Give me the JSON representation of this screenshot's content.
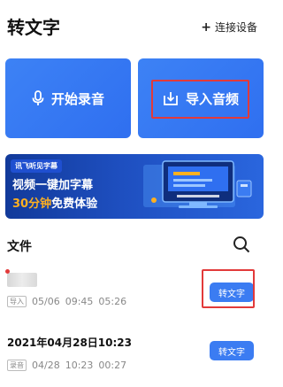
{
  "header": {
    "title": "转文字",
    "connect_label": "连接设备",
    "connect_icon": "plus-icon"
  },
  "actions": {
    "record_label": "开始录音",
    "record_icon": "microphone-icon",
    "import_label": "导入音频",
    "import_icon": "import-download-icon",
    "card_color": "#3478f6"
  },
  "banner": {
    "brand": "讯飞听见字幕",
    "line1": "视频一键加字幕",
    "line2_accent": "30分钟",
    "line2_rest": "免费体验"
  },
  "files": {
    "title": "文件",
    "search_icon": "search-icon",
    "items": [
      {
        "name": "",
        "tag": "导入",
        "date": "05/06",
        "time": "09:45",
        "duration": "05:26",
        "button": "转文字",
        "unread": true
      },
      {
        "name": "2021年04月28日10:23",
        "tag": "录音",
        "date": "04/28",
        "time": "10:23",
        "duration": "00:27",
        "button": "转文字",
        "unread": false
      }
    ]
  },
  "colors": {
    "primary": "#3b7cf2",
    "highlight": "#e23a3a",
    "banner_accent": "#ffb020"
  }
}
